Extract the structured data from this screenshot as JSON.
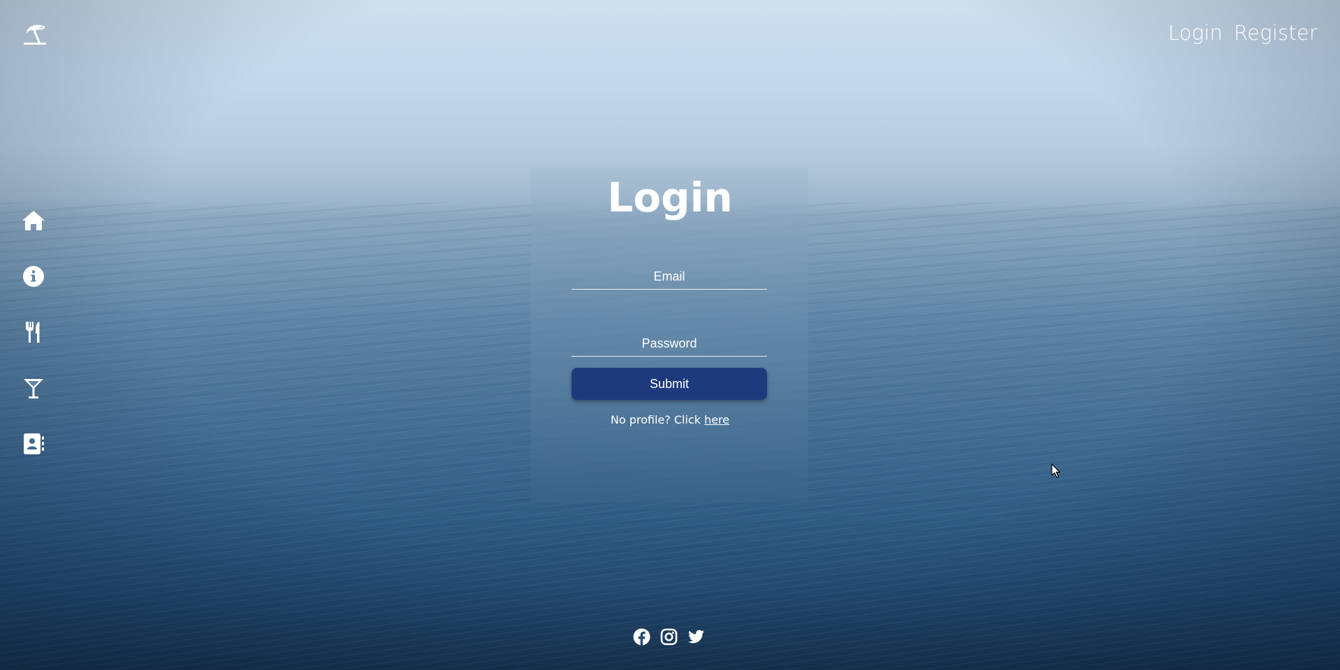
{
  "header": {
    "logo_icon": "beach-umbrella-icon",
    "nav": [
      {
        "label": "Login"
      },
      {
        "label": "Register"
      }
    ]
  },
  "sidebar": {
    "items": [
      {
        "icon": "home-icon"
      },
      {
        "icon": "info-icon"
      },
      {
        "icon": "utensils-icon"
      },
      {
        "icon": "cocktail-icon"
      },
      {
        "icon": "contact-book-icon"
      }
    ]
  },
  "login_form": {
    "title": "Login",
    "email_placeholder": "Email",
    "password_placeholder": "Password",
    "submit_label": "Submit",
    "register_prompt": "No profile? Click",
    "register_link": "here"
  },
  "social": [
    {
      "icon": "facebook-icon"
    },
    {
      "icon": "instagram-icon"
    },
    {
      "icon": "twitter-icon"
    }
  ],
  "colors": {
    "submit_button": "#1f3a7c",
    "text": "#ffffff",
    "sky": "#cfe0ee",
    "sea_deep": "#17324f"
  }
}
